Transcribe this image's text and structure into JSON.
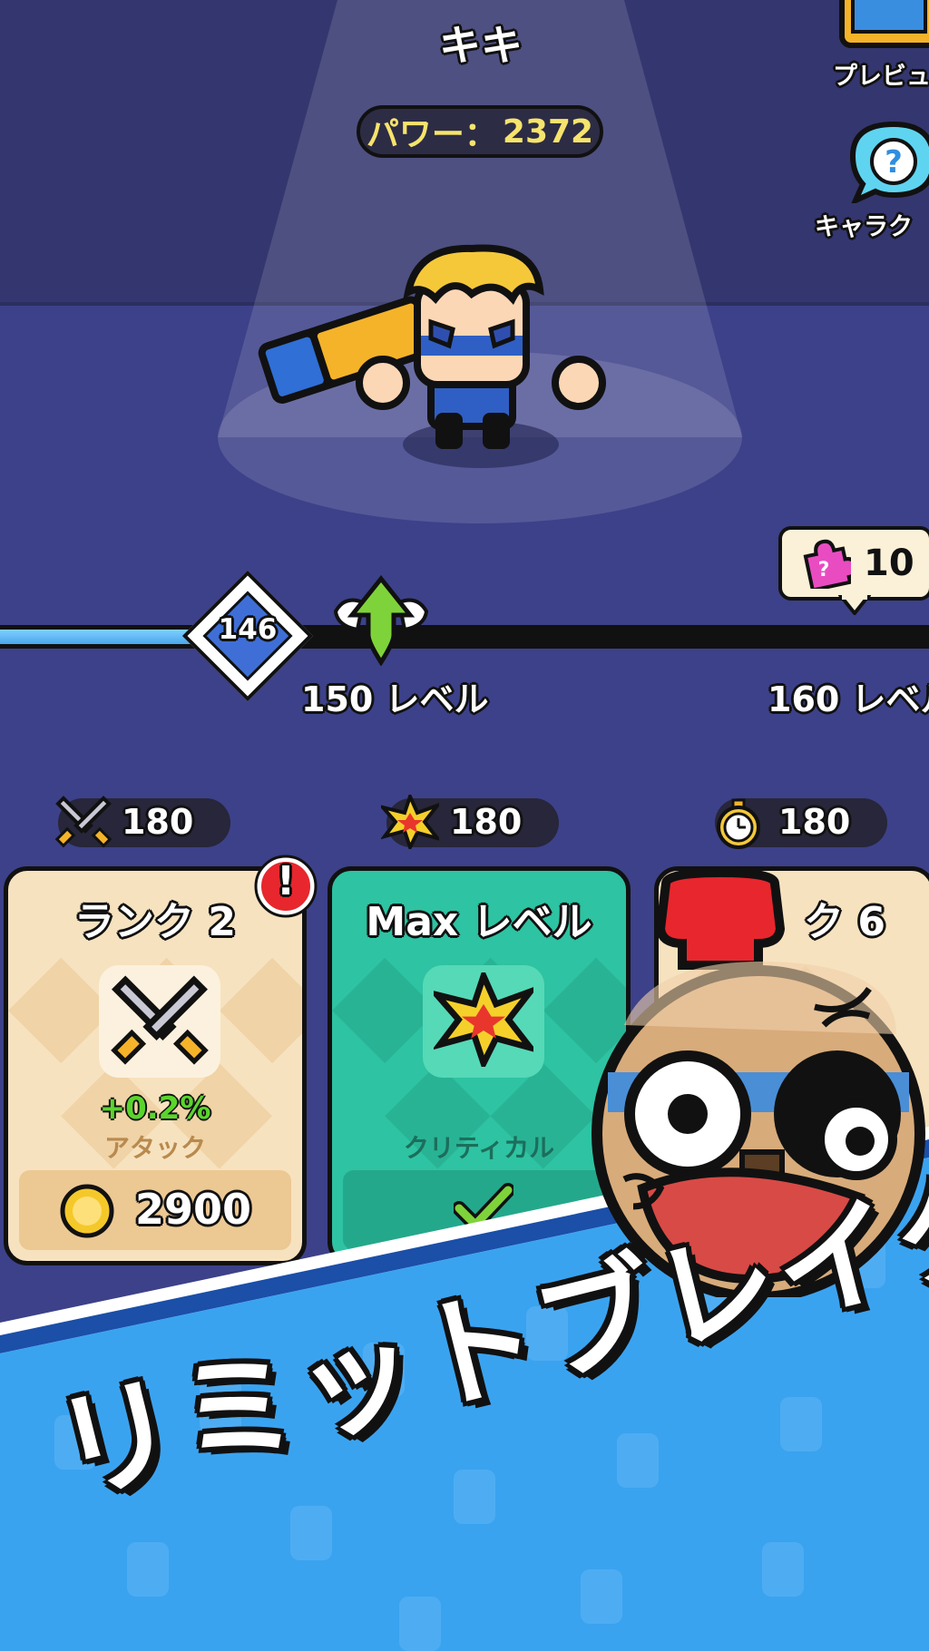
{
  "character": {
    "name": "キキ",
    "power_label": "パワー：",
    "power_value": "2372"
  },
  "side_buttons": {
    "preview_label": "プレビュ",
    "character_label": "キャラク"
  },
  "puzzle_badge": {
    "count": "10"
  },
  "level_progress": {
    "current_level": "146",
    "progress_fraction": 0.21,
    "milestones": [
      {
        "label": "150 レベル"
      },
      {
        "label": "160 レベル"
      }
    ]
  },
  "stats": [
    {
      "icon": "crossed-swords-icon",
      "value": "180"
    },
    {
      "icon": "critical-burst-icon",
      "value": "180"
    },
    {
      "icon": "stopwatch-icon",
      "value": "180"
    }
  ],
  "cards": [
    {
      "title": "ランク 2",
      "icon": "crossed-swords-icon",
      "bonus": "+0.2%",
      "stat": "アタック",
      "cost": "2900",
      "alert": "!"
    },
    {
      "title": "Max レベル",
      "icon": "critical-burst-icon",
      "stat": "クリティカル",
      "status": "check"
    },
    {
      "title": "ク 6"
    }
  ],
  "banner": {
    "text": "リミットブレイク！"
  },
  "colors": {
    "power_text": "#f6e46c",
    "bonus_green": "#5ad52c",
    "card_cream": "#f7e2bf",
    "card_green": "#2ec3a2",
    "banner_blue": "#3aa3f0"
  }
}
